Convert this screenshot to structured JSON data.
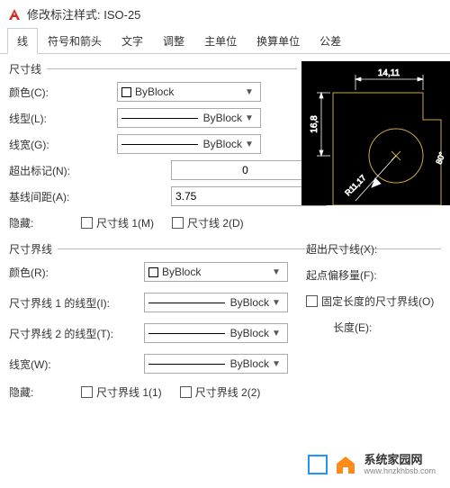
{
  "title": "修改标注样式: ISO-25",
  "tabs": [
    "线",
    "符号和箭头",
    "文字",
    "调整",
    "主单位",
    "换算单位",
    "公差"
  ],
  "activeTab": 0,
  "dimLines": {
    "title": "尺寸线",
    "color": {
      "label": "颜色(C):",
      "value": "ByBlock"
    },
    "linetype": {
      "label": "线型(L):",
      "value": "ByBlock"
    },
    "lineweight": {
      "label": "线宽(G):",
      "value": "ByBlock"
    },
    "extendBeyond": {
      "label": "超出标记(N):",
      "value": "0"
    },
    "baselineSpacing": {
      "label": "基线间距(A):",
      "value": "3.75"
    },
    "suppress": {
      "label": "隐藏:",
      "opt1": "尺寸线 1(M)",
      "opt2": "尺寸线 2(D)"
    }
  },
  "extLines": {
    "title": "尺寸界线",
    "color": {
      "label": "颜色(R):",
      "value": "ByBlock"
    },
    "linetype1": {
      "label": "尺寸界线 1 的线型(I):",
      "value": "ByBlock"
    },
    "linetype2": {
      "label": "尺寸界线 2 的线型(T):",
      "value": "ByBlock"
    },
    "lineweight": {
      "label": "线宽(W):",
      "value": "ByBlock"
    },
    "suppress": {
      "label": "隐藏:",
      "opt1": "尺寸界线 1(1)",
      "opt2": "尺寸界线 2(2)"
    },
    "extendBeyond": {
      "label": "超出尺寸线(X):"
    },
    "offsetOrigin": {
      "label": "起点偏移量(F):"
    },
    "fixedLength": {
      "label": "固定长度的尺寸界线(O)"
    },
    "length": {
      "label": "长度(E):"
    }
  },
  "preview": {
    "dim1": "14,11",
    "dim2": "16,8",
    "dim3": "R11,17",
    "dim4": "80°"
  },
  "watermark": {
    "main": "系统家园网",
    "sub": "www.hnzkhbsb.com"
  }
}
